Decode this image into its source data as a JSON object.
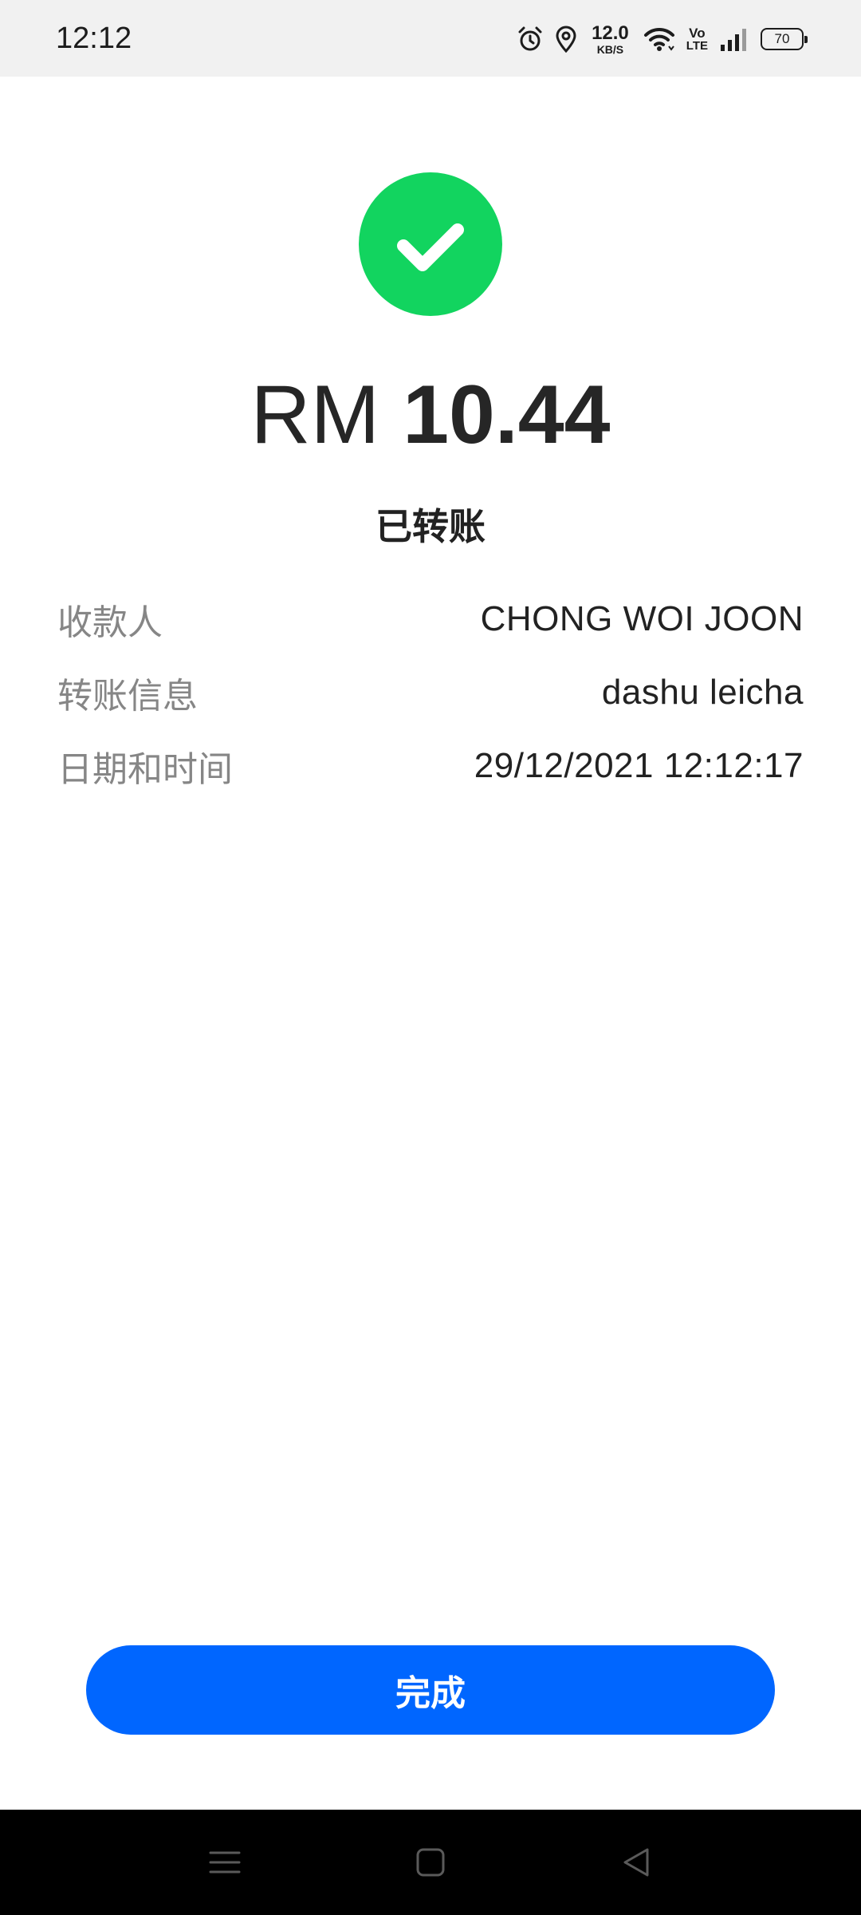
{
  "status_bar": {
    "time": "12:12",
    "net_speed_value": "12.0",
    "net_speed_unit": "KB/S",
    "volte_top": "Vo",
    "volte_bottom": "LTE",
    "battery_level": "70",
    "icons": [
      "alarm-icon",
      "location-icon",
      "wifi-icon",
      "signal-icon",
      "battery-icon"
    ]
  },
  "transfer": {
    "currency": "RM",
    "amount": "10.44",
    "status": "已转账",
    "details": [
      {
        "label": "收款人",
        "value": "CHONG WOI JOON"
      },
      {
        "label": "转账信息",
        "value": "dashu leicha"
      },
      {
        "label": "日期和时间",
        "value": "29/12/2021 12:12:17"
      }
    ]
  },
  "actions": {
    "done_label": "完成"
  },
  "nav_bar": {
    "buttons": [
      "menu-icon",
      "home-icon",
      "back-icon"
    ]
  },
  "colors": {
    "success_green": "#12d45f",
    "primary_blue": "#0066ff",
    "label_gray": "#868686"
  }
}
